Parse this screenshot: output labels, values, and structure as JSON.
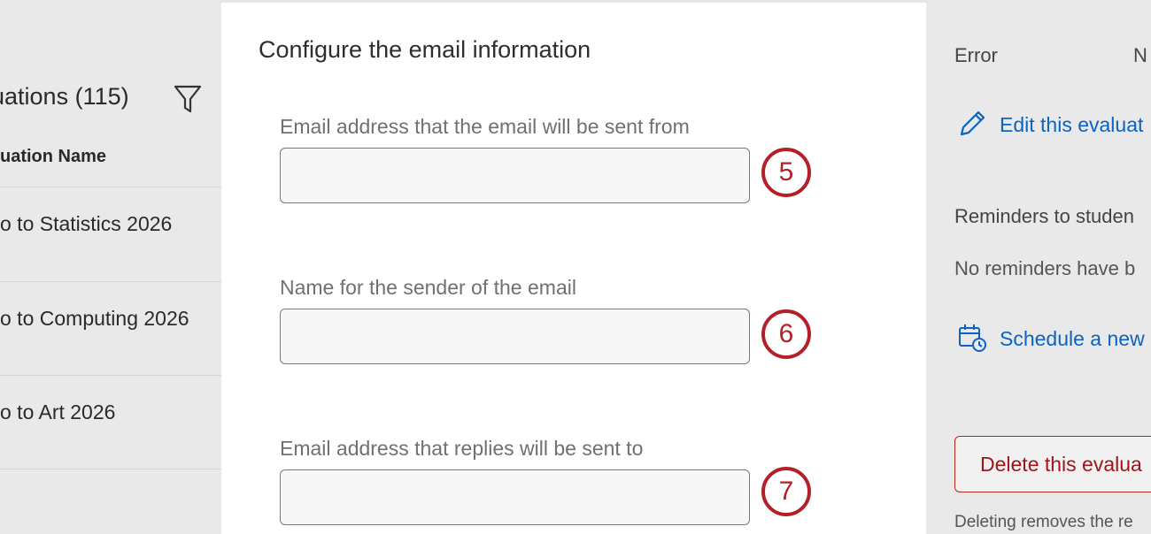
{
  "background": {
    "list_title": "uations (115)",
    "column_header": "uation Name",
    "rows": [
      "o to Statistics 2026",
      "o to Computing 2026",
      "o to Art 2026"
    ]
  },
  "right_panel": {
    "error_label": "Error",
    "error_value": "N",
    "edit_link": "Edit this evaluat",
    "reminders_label": "Reminders to studen",
    "reminders_text": "No reminders have b",
    "schedule_link": "Schedule a new",
    "delete_button": "Delete this evalua",
    "delete_note": "Deleting removes the re"
  },
  "modal": {
    "heading": "Configure the email information",
    "fields": [
      {
        "label": "Email address that the email will be sent from",
        "value": "",
        "callout": "5"
      },
      {
        "label": "Name for the sender of the email",
        "value": "",
        "callout": "6"
      },
      {
        "label": "Email address that replies will be sent to",
        "value": "",
        "callout": "7"
      }
    ]
  },
  "colors": {
    "link": "#0b63c4",
    "danger": "#b3261e",
    "callout": "#b3202a"
  }
}
